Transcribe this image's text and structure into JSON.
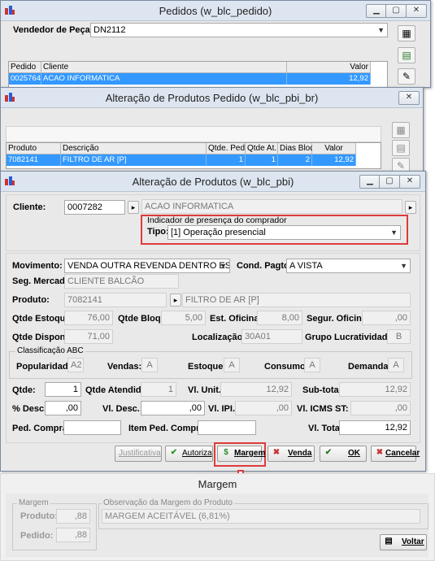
{
  "pedidos": {
    "title": "Pedidos (w_blc_pedido)",
    "vendedor_label": "Vendedor de Peças:",
    "vendedor_value": "DN2112",
    "grid": {
      "headers": [
        "Pedido",
        "Cliente",
        "Valor"
      ],
      "row": [
        "0025764",
        "ACAO INFORMATICA",
        "12,92"
      ]
    }
  },
  "alteracao_produtos_pedido": {
    "title": "Alteração de Produtos Pedido (w_blc_pbi_br)",
    "grid": {
      "headers": [
        "Produto",
        "Descrição",
        "Qtde. Ped.",
        "Qtde At.",
        "Dias Bloq",
        "Valor"
      ],
      "row": [
        "7082141",
        "FILTRO DE AR [P]",
        "1",
        "1",
        "2",
        "12,92"
      ]
    }
  },
  "alteracao_produtos": {
    "title": "Alteração de Produtos (w_blc_pbi)",
    "cliente_label": "Cliente:",
    "cliente_code": "0007282",
    "cliente_name": "ACAO INFORMATICA",
    "indicador_title": "Indicador de presença do comprador",
    "tipo_label": "Tipo:",
    "tipo_value": "[1] Operação presencial",
    "movimento_label": "Movimento:",
    "movimento_value": "VENDA OUTRA REVENDA DENTRO ESTAD",
    "cond_pagto_label": "Cond. Pagto:",
    "cond_pagto_value": "A VISTA",
    "seg_mercado_label": "Seg. Mercado:",
    "seg_mercado_value": "CLIENTE BALCÃO",
    "produto_label": "Produto:",
    "produto_code": "7082141",
    "produto_desc": "FILTRO DE AR [P]",
    "qtde_estoque_label": "Qtde Estoque:",
    "qtde_estoque_value": "76,00",
    "qtde_bloq_label": "Qtde Bloq.:",
    "qtde_bloq_value": "5,00",
    "est_oficina_label": "Est. Oficina:",
    "est_oficina_value": "8,00",
    "segur_oficina_label": "Segur. Oficina:",
    "segur_oficina_value": ",00",
    "qtde_dispon_label": "Qtde Dispon.:",
    "qtde_dispon_value": "71,00",
    "localizacao_label": "Localização:",
    "localizacao_value": "30A01",
    "grupo_lucrat_label": "Grupo Lucratividade:",
    "grupo_lucrat_value": "B",
    "classificacao_title": "Classificação ABC",
    "popularidade_label": "Popularidade:",
    "popularidade_value": "A2",
    "vendas_label": "Vendas:",
    "vendas_value": "A",
    "estoque_label": "Estoque:",
    "estoque_value": "A",
    "consumo_label": "Consumo:",
    "consumo_value": "A",
    "demanda_label": "Demanda:",
    "demanda_value": "A",
    "qtde_label": "Qtde:",
    "qtde_value": "1",
    "qtde_atendida_label": "Qtde Atendida:",
    "qtde_atendida_value": "1",
    "vl_unit_label": "Vl. Unit.:",
    "vl_unit_value": "12,92",
    "sub_total_label": "Sub-total:",
    "sub_total_value": "12,92",
    "pct_desc_label": "% Desc.:",
    "pct_desc_value": ",00",
    "vl_desc_label": "Vl. Desc.:",
    "vl_desc_value": ",00",
    "vl_ipi_label": "Vl. IPI.:",
    "vl_ipi_value": ",00",
    "vl_icms_st_label": "Vl. ICMS ST:",
    "vl_icms_st_value": ",00",
    "ped_compra_label": "Ped. Compra:",
    "ped_compra_value": "",
    "item_ped_compra_label": "Item Ped. Compra:",
    "item_ped_compra_value": "",
    "vl_total_label": "Vl. Total:",
    "vl_total_value": "12,92",
    "buttons": {
      "justificativa": "Justificativa",
      "autoriza": "Autoriza",
      "margem": "Margem",
      "venda": "Venda",
      "ok": "OK",
      "cancelar": "Cancelar"
    }
  },
  "margem": {
    "title": "Margem",
    "group_label": "Margem",
    "produto_label": "Produto:",
    "produto_value": ",88",
    "pedido_label": "Pedido:",
    "pedido_value": ",88",
    "obs_label": "Observação da Margem do Produto",
    "obs_value": "MARGEM ACEITÁVEL (6,81%)",
    "voltar": "Voltar"
  },
  "colors": {
    "selection": "#3399ff",
    "highlight_border": "#e03a3a",
    "arrow": "#e03a3a"
  }
}
